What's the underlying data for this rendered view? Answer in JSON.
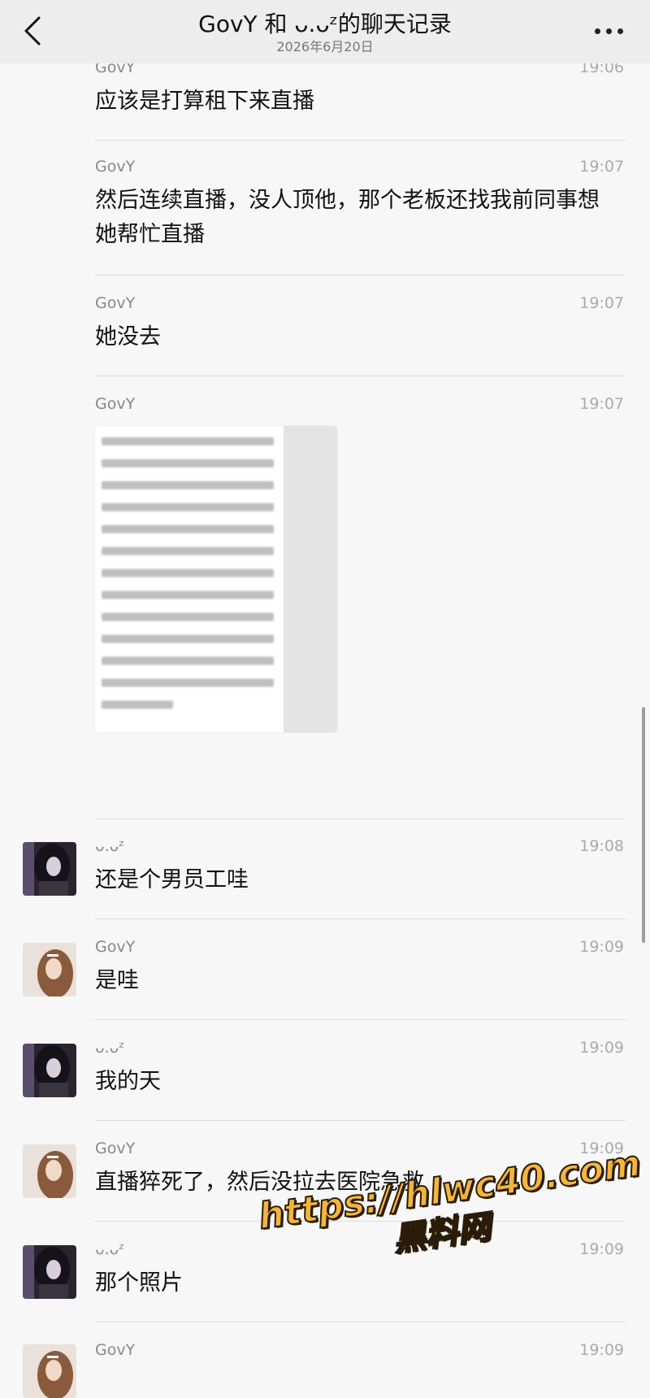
{
  "header": {
    "title": "GovY 和 ᴗ.ᴗᶻ的聊天记录",
    "date": "2026年6月20日",
    "back_icon": "chevron-left-icon",
    "more_icon": "more-horizontal-icon"
  },
  "messages": [
    {
      "sender": "GovY",
      "time": "19:06",
      "text": "应该是打算租下来直播",
      "avatar": ""
    },
    {
      "sender": "GovY",
      "time": "19:07",
      "text": "然后连续直播，没人顶他，那个老板还找我前同事想她帮忙直播",
      "avatar": ""
    },
    {
      "sender": "GovY",
      "time": "19:07",
      "text": "她没去",
      "avatar": ""
    },
    {
      "sender": "GovY",
      "time": "19:07",
      "text": "",
      "image": "screenshot-of-text",
      "avatar": ""
    },
    {
      "sender": "ᴗ.ᴗᶻ",
      "time": "19:08",
      "text": "还是个男员工哇",
      "avatar": "dark-hair-avatar"
    },
    {
      "sender": "GovY",
      "time": "19:09",
      "text": "是哇",
      "avatar": "brown-hair-avatar"
    },
    {
      "sender": "ᴗ.ᴗᶻ",
      "time": "19:09",
      "text": "我的天",
      "avatar": "dark-hair-avatar"
    },
    {
      "sender": "GovY",
      "time": "19:09",
      "text": "直播猝死了，然后没拉去医院急救",
      "avatar": "brown-hair-avatar"
    },
    {
      "sender": "ᴗ.ᴗᶻ",
      "time": "19:09",
      "text": "那个照片",
      "avatar": "dark-hair-avatar"
    },
    {
      "sender": "GovY",
      "time": "19:09",
      "text": "",
      "avatar": "brown-hair-avatar"
    }
  ],
  "watermark": {
    "url": "https://hlwc40.com",
    "name": "黑料网",
    "color": "#f4b53c"
  }
}
